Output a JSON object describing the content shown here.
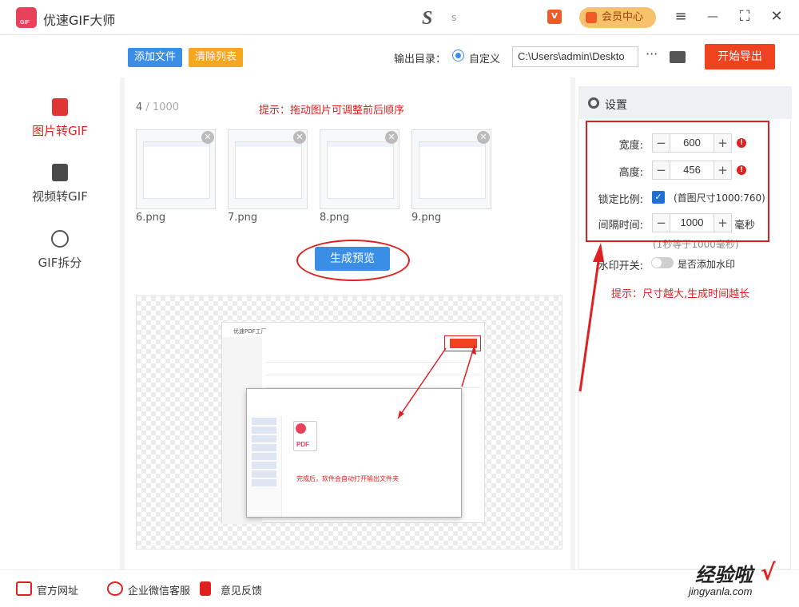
{
  "app": {
    "title": "优速GIF大师",
    "center_text": "s",
    "vip_badge": "V",
    "member_label": "会员中心"
  },
  "window_controls": {
    "menu": "≡",
    "maximize": "⛶",
    "close": "✕"
  },
  "sidebar": {
    "items": [
      {
        "label": "图片转GIF",
        "active": true,
        "icon": "image-icon"
      },
      {
        "label": "视频转GIF",
        "active": false,
        "icon": "video-icon"
      },
      {
        "label": "GIF拆分",
        "active": false,
        "icon": "split-icon"
      }
    ]
  },
  "toolbar": {
    "add_file": "添加文件",
    "clear_list": "清除列表",
    "output_label": "输出目录：",
    "custom_label": "自定义",
    "path_value": "C:\\Users\\admin\\Deskto",
    "browse": "···",
    "export": "开始导出"
  },
  "main": {
    "counter_current": "4",
    "counter_total": " / 1000",
    "hint": "提示：拖动图片可调整前后顺序",
    "thumbs": [
      {
        "name": "6.png"
      },
      {
        "name": "7.png"
      },
      {
        "name": "8.png"
      },
      {
        "name": "9.png"
      }
    ],
    "preview_button": "生成预览",
    "preview": {
      "window_title": "优速PDF工厂",
      "explorer_message": "完成后，软件会自动打开输出文件夹"
    }
  },
  "settings": {
    "title": "设置",
    "width_label": "宽度:",
    "width_value": "600",
    "height_label": "高度:",
    "height_value": "456",
    "lock_label": "锁定比例:",
    "lock_note": "(首图尺寸1000:760)",
    "interval_label": "间隔时间:",
    "interval_value": "1000",
    "interval_unit": "毫秒",
    "interval_note": "(1秒等于1000毫秒)",
    "watermark_label": "水印开关:",
    "watermark_note": "是否添加水印",
    "tip": "提示：尺寸越大,生成时间越长",
    "minus": "−",
    "plus": "+"
  },
  "footer": {
    "website": "官方网址",
    "wechat": "企业微信客服",
    "feedback": "意见反馈"
  },
  "watermark": {
    "main": "经验啦",
    "sub": "jingyanla.com",
    "check": "√"
  },
  "colors": {
    "accent_blue": "#3a8ee6",
    "accent_red": "#e02020",
    "export_red": "#f0421f",
    "orange": "#f5a623"
  }
}
